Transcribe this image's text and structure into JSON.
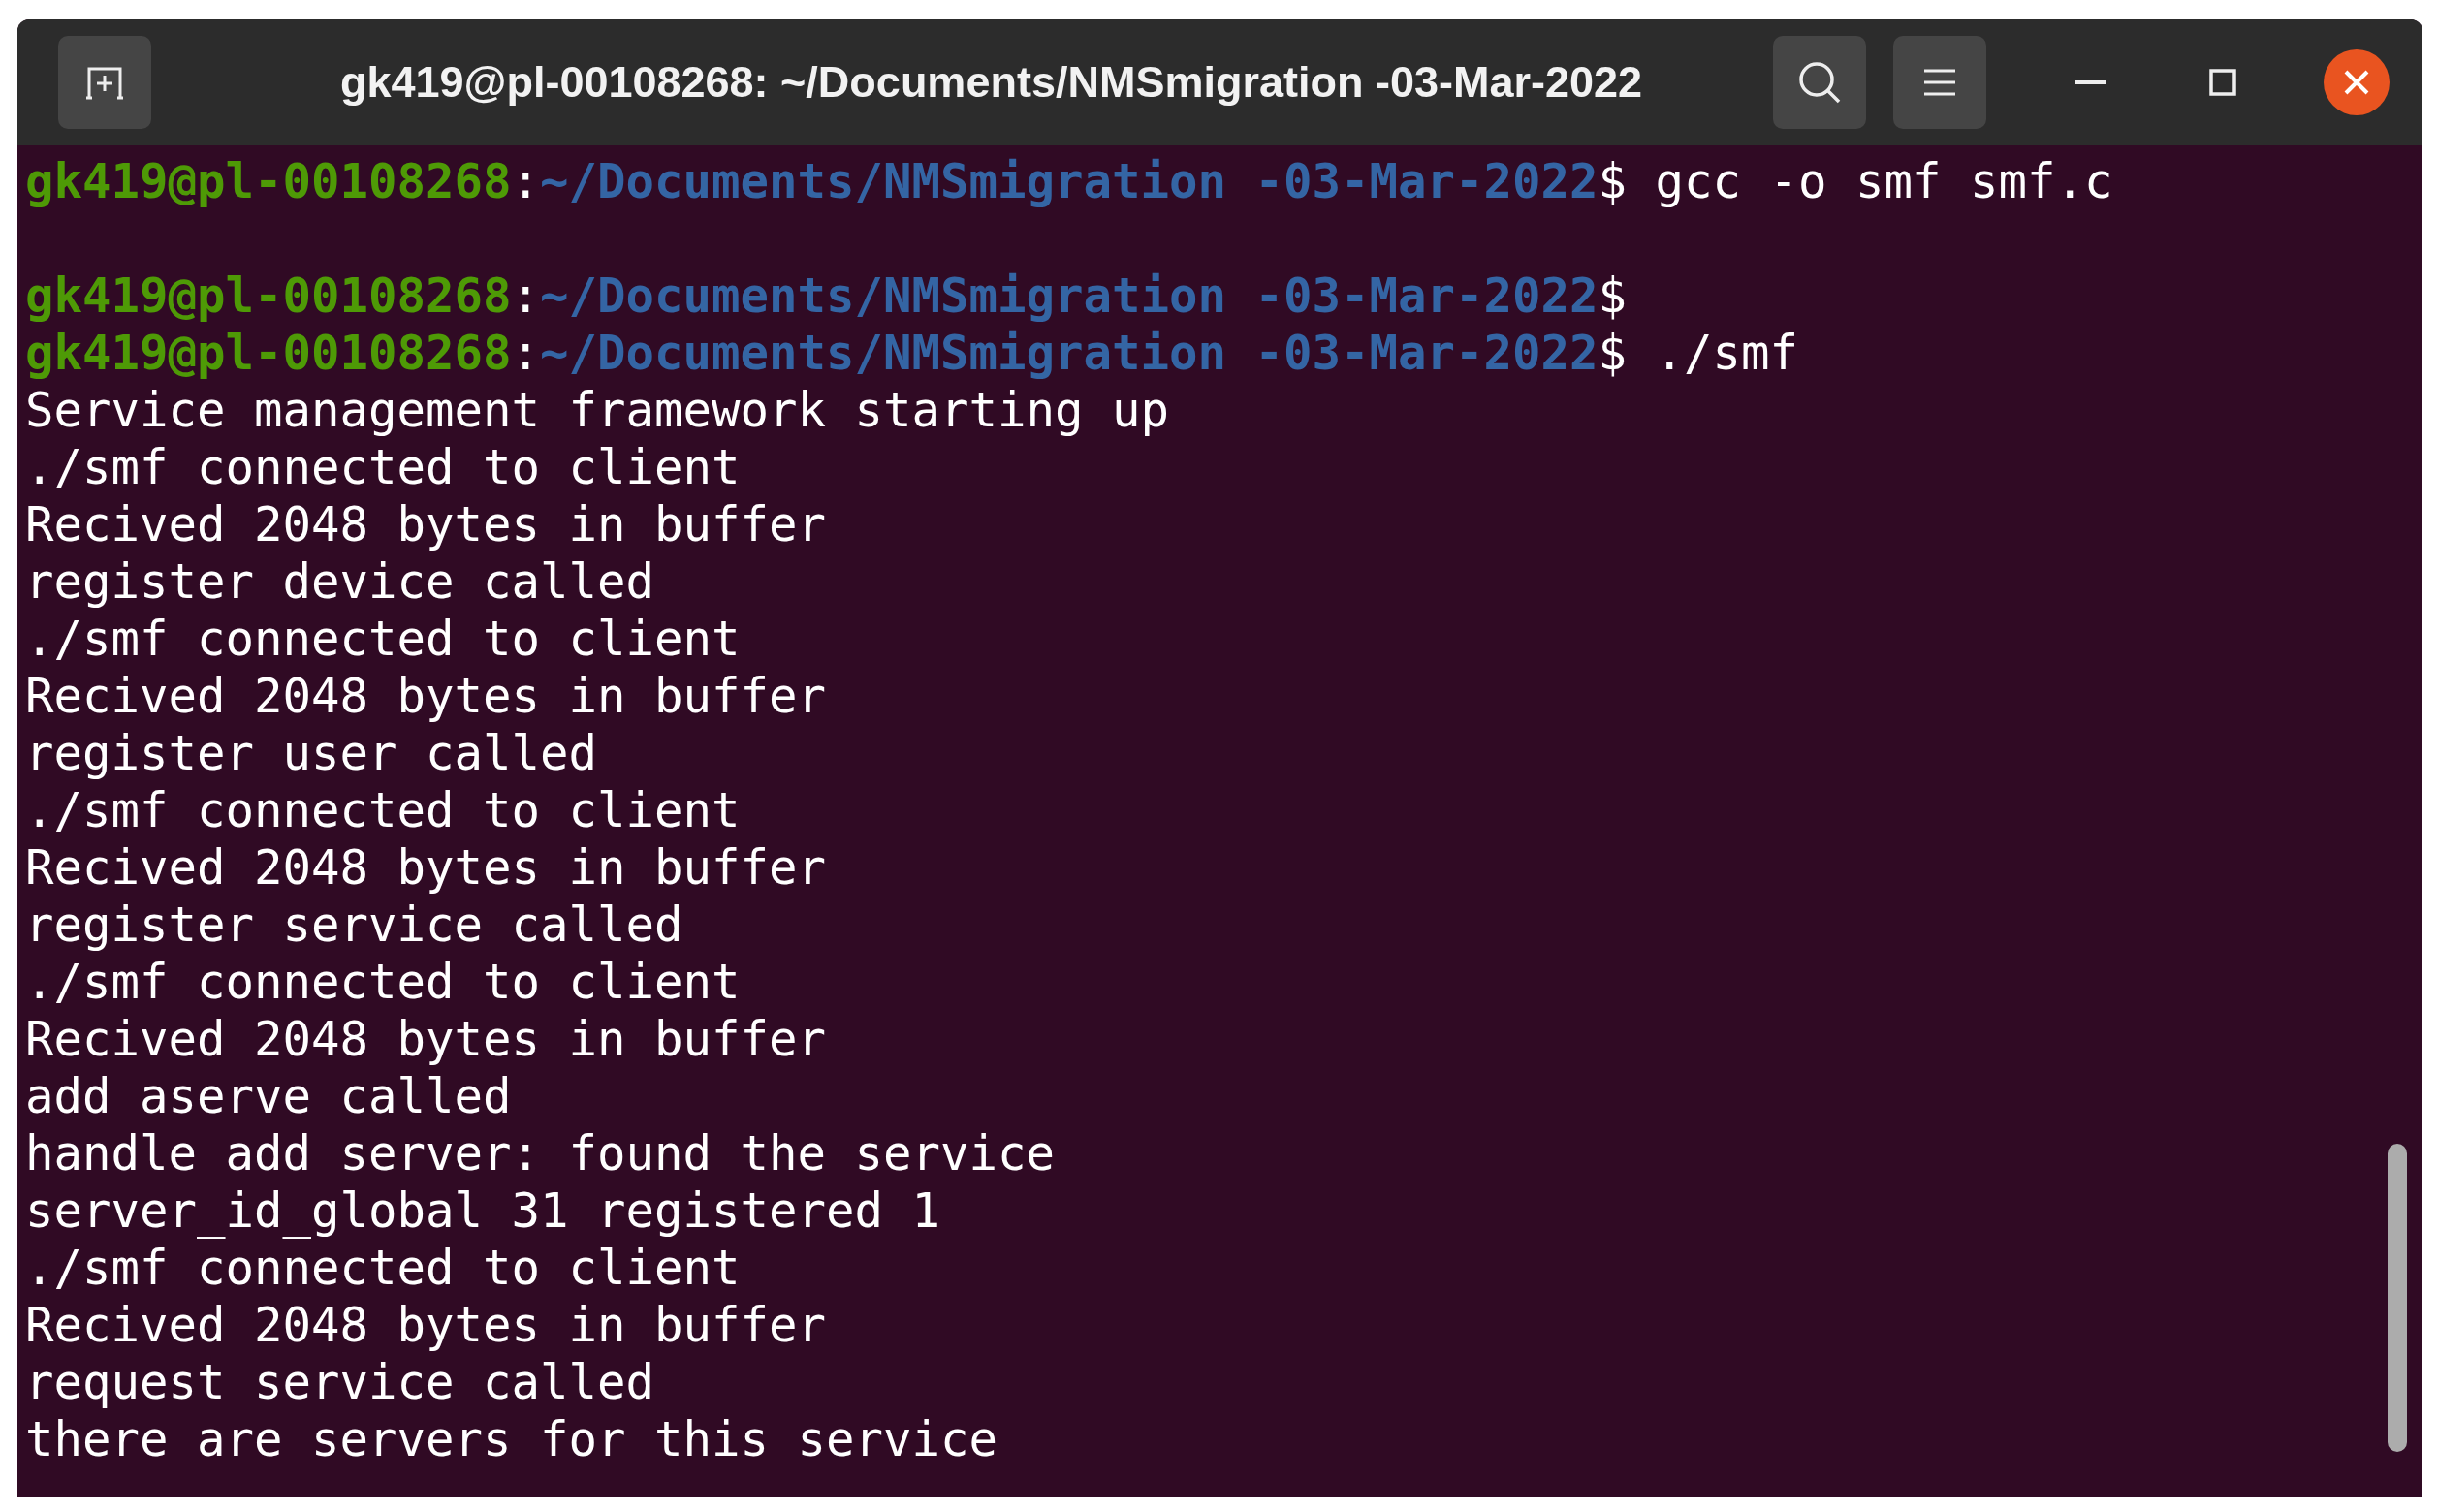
{
  "window": {
    "title": "gk419@pl-00108268: ~/Documents/NMSmigration -03-Mar-2022"
  },
  "terminal": {
    "lines": [
      {
        "kind": "prompt",
        "user": "gk419@pl-00108268",
        "separator": ":",
        "path": "~/Documents/NMSmigration -03-Mar-2022",
        "command": "$ gcc -o smf smf.c"
      },
      {
        "kind": "blank"
      },
      {
        "kind": "prompt",
        "user": "gk419@pl-00108268",
        "separator": ":",
        "path": "~/Documents/NMSmigration -03-Mar-2022",
        "command": "$"
      },
      {
        "kind": "prompt",
        "user": "gk419@pl-00108268",
        "separator": ":",
        "path": "~/Documents/NMSmigration -03-Mar-2022",
        "command": "$ ./smf"
      },
      {
        "kind": "output",
        "text": "Service management framework starting up"
      },
      {
        "kind": "output",
        "text": "./smf connected to client"
      },
      {
        "kind": "output",
        "text": "Recived 2048 bytes in buffer"
      },
      {
        "kind": "output",
        "text": "register device called"
      },
      {
        "kind": "output",
        "text": "./smf connected to client"
      },
      {
        "kind": "output",
        "text": "Recived 2048 bytes in buffer"
      },
      {
        "kind": "output",
        "text": "register user called"
      },
      {
        "kind": "output",
        "text": "./smf connected to client"
      },
      {
        "kind": "output",
        "text": "Recived 2048 bytes in buffer"
      },
      {
        "kind": "output",
        "text": "register service called"
      },
      {
        "kind": "output",
        "text": "./smf connected to client"
      },
      {
        "kind": "output",
        "text": "Recived 2048 bytes in buffer"
      },
      {
        "kind": "output",
        "text": "add aserve called"
      },
      {
        "kind": "output",
        "text": "handle add server: found the service"
      },
      {
        "kind": "output",
        "text": "server_id_global 31 registered 1"
      },
      {
        "kind": "output",
        "text": "./smf connected to client"
      },
      {
        "kind": "output",
        "text": "Recived 2048 bytes in buffer"
      },
      {
        "kind": "output",
        "text": "request service called"
      },
      {
        "kind": "output",
        "text": "there are servers for this service"
      }
    ]
  }
}
